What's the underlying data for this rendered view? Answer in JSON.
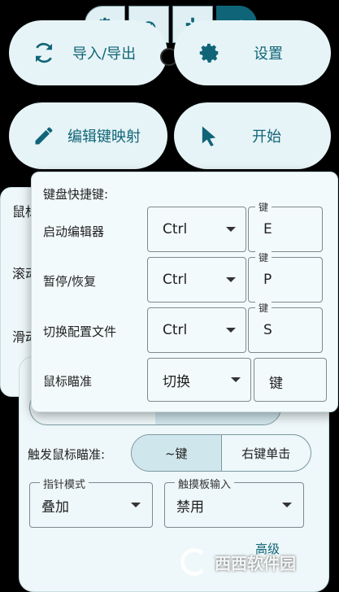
{
  "tabs": [
    {
      "icon": "gear-icon"
    },
    {
      "icon": "speedometer-icon"
    },
    {
      "icon": "gamepad-icon"
    },
    {
      "icon": "check-icon"
    }
  ],
  "main_buttons": {
    "import_export": "导入/导出",
    "settings": "设置",
    "edit_mapping": "编辑键映射",
    "start": "开始"
  },
  "background_panel": {
    "labels": [
      "鼠标",
      "滚动",
      "滑动"
    ]
  },
  "popup": {
    "title": "键盘快捷键:",
    "key_legend": "键",
    "rows": [
      {
        "label": "启动编辑器",
        "modifier": "Ctrl",
        "key": "E"
      },
      {
        "label": "暂停/恢复",
        "modifier": "Ctrl",
        "key": "P"
      },
      {
        "label": "切换配置文件",
        "modifier": "Ctrl",
        "key": "S"
      }
    ],
    "aim_row": {
      "label": "鼠标瞄准",
      "mode": "切换",
      "key_placeholder": "键"
    }
  },
  "mouse_panel": {
    "trigger_label": "触发鼠标瞄准:",
    "trigger_options": [
      "~键",
      "右键单击"
    ],
    "pointer_mode": {
      "legend": "指针模式",
      "value": "叠加"
    },
    "touchpad_input": {
      "legend": "触摸板输入",
      "value": "禁用"
    },
    "partial_text": "高级"
  },
  "watermark": "西西软件园",
  "colors": {
    "accent": "#0f6577",
    "pill_bg": "#e7f4f7"
  }
}
